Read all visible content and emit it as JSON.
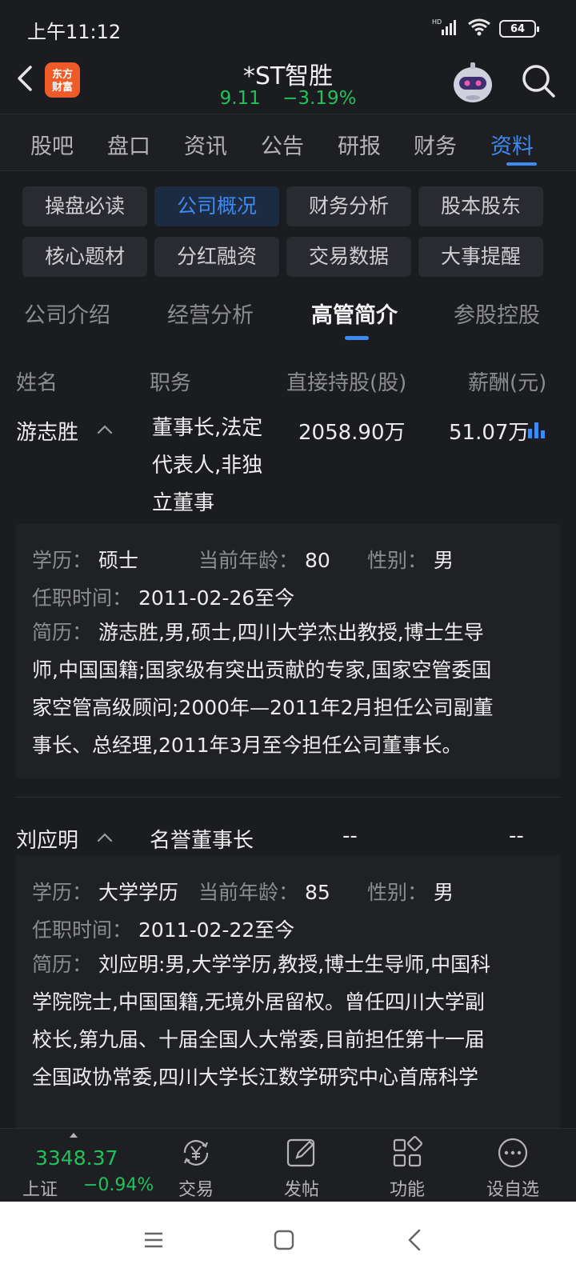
{
  "status_bar": {
    "time": "上午11:12",
    "network": "HD",
    "battery": "64"
  },
  "header": {
    "logo_text": "东方财富",
    "stock_name": "*ST智胜",
    "price": "9.11",
    "change_pct": "−3.19%"
  },
  "main_tabs": [
    "股吧",
    "盘口",
    "资讯",
    "公告",
    "研报",
    "财务",
    "资料"
  ],
  "main_tab_active": "资料",
  "chips": [
    "操盘必读",
    "公司概况",
    "财务分析",
    "股本股东",
    "核心题材",
    "分红融资",
    "交易数据",
    "大事提醒"
  ],
  "chip_active": "公司概况",
  "sub_tabs": [
    "公司介绍",
    "经营分析",
    "高管简介",
    "参股控股"
  ],
  "sub_tab_active": "高管简介",
  "columns": [
    "姓名",
    "职务",
    "直接持股(股)",
    "薪酬(元)"
  ],
  "executives": [
    {
      "name": "游志胜",
      "role": "董事长,法定代表人,非独立董事",
      "role_lines": [
        "董事长,法定",
        "代表人,非独",
        "立董事"
      ],
      "shares": "2058.90万",
      "salary": "51.07万",
      "education_label": "学历：",
      "education": "硕士",
      "age_label": "当前年龄：",
      "age": "80",
      "gender_label": "性别：",
      "gender": "男",
      "tenure_label": "任职时间：",
      "tenure": "2011-02-26至今",
      "bio_label": "简历：",
      "bio": "游志胜,男,硕士,四川大学杰出教授,博士生导师,中国国籍;国家级有突出贡献的专家,国家空管委国家空管高级顾问;2000年—2011年2月担任公司副董事长、总经理,2011年3月至今担任公司董事长。",
      "bio_lines": [
        "游志胜,男,硕士,四川大学杰出教授,博士生导",
        "师,中国国籍;国家级有突出贡献的专家,国家空管委国",
        "家空管高级顾问;2000年—2011年2月担任公司副董",
        "事长、总经理,2011年3月至今担任公司董事长。"
      ]
    },
    {
      "name": "刘应明",
      "role": "名誉董事长",
      "shares": "--",
      "salary": "--",
      "education_label": "学历：",
      "education": "大学学历",
      "age_label": "当前年龄：",
      "age": "85",
      "gender_label": "性别：",
      "gender": "男",
      "tenure_label": "任职时间：",
      "tenure": "2011-02-22至今",
      "bio_label": "简历：",
      "bio_lines": [
        "刘应明:男,大学学历,教授,博士生导师,中国科",
        "学院院士,中国国籍,无境外居留权。曾任四川大学副",
        "校长,第九届、十届全国人大常委,目前担任第十一届",
        "全国政协常委,四川大学长江数学研究中心首席科学"
      ]
    }
  ],
  "bottom_bar": {
    "index_value": "3348.37",
    "index_name": "上证",
    "index_change": "−0.94%",
    "items": [
      "交易",
      "发帖",
      "功能",
      "设自选"
    ]
  },
  "colors": {
    "accent": "#3d8af2",
    "down_green": "#21c25a",
    "background": "#1b1c20",
    "logo_orange": "#ec5b28"
  }
}
